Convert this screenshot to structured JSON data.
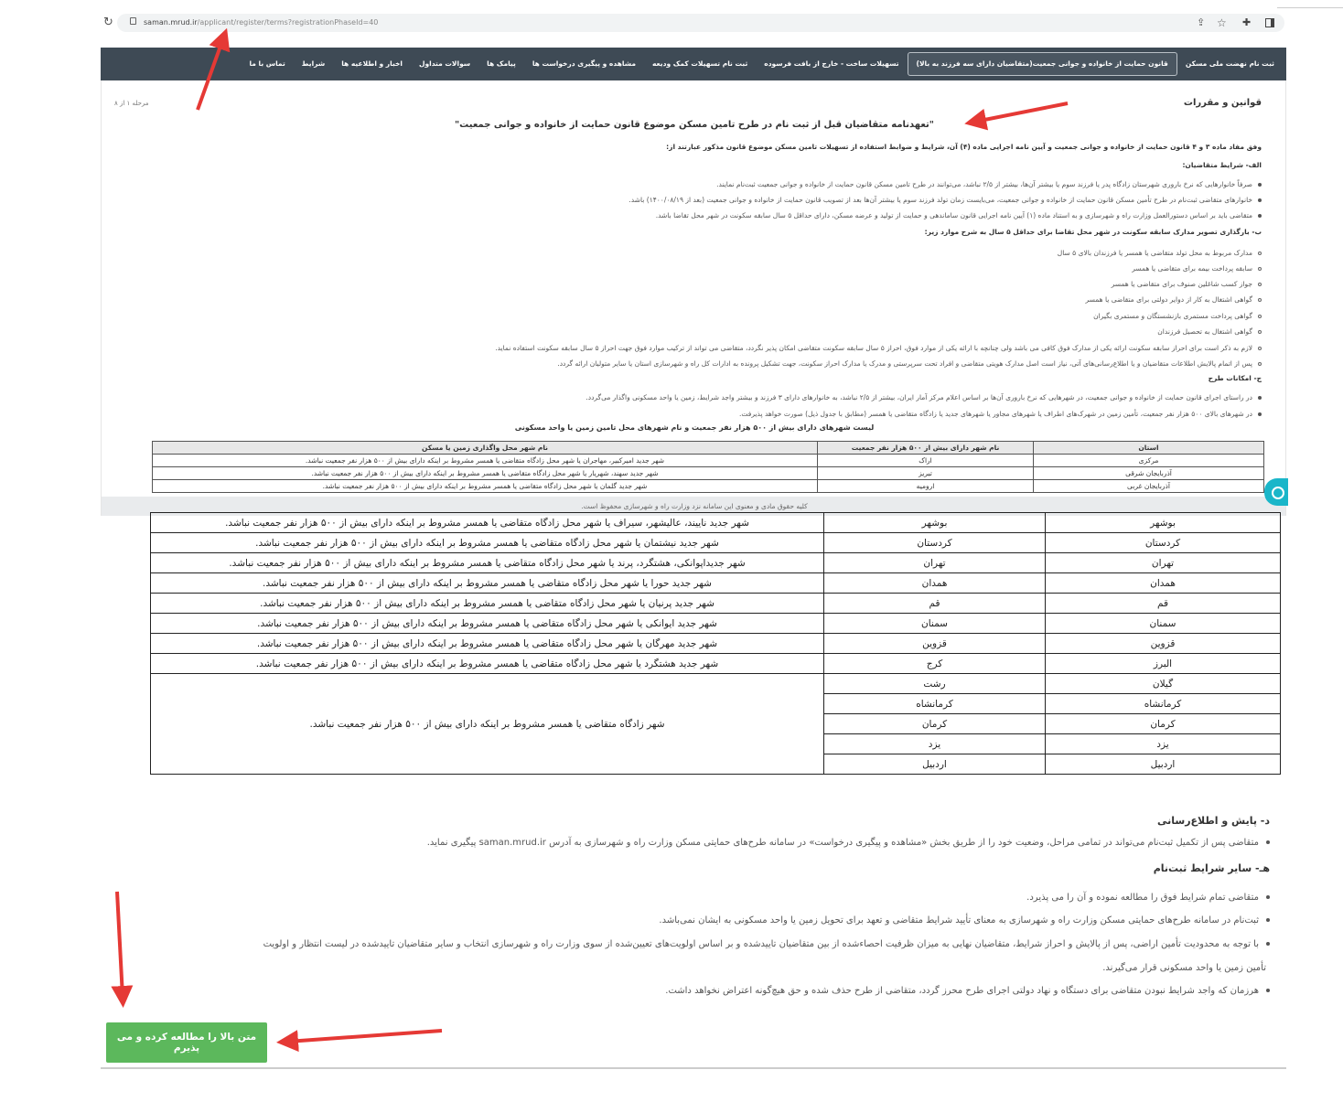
{
  "browser": {
    "url_host": "saman.mrud.ir",
    "url_path": "/applicant/register/terms?registrationPhaseId=40"
  },
  "nav": {
    "items": [
      "ثبت نام نهضت ملی مسکن",
      "قانون حمایت از خانواده و جوانی جمعیت(متقاضیان دارای سه فرزند به بالا)",
      "تسهیلات ساخت - خارج از بافت فرسوده",
      "ثبت نام تسهیلات کمک ودیعه",
      "مشاهده و پیگیری درخواست ها",
      "پیامک ها",
      "سوالات متداول",
      "اخبار و اطلاعیه ها",
      "شرایط",
      "تماس با ما"
    ]
  },
  "page": {
    "section_title": "قوانین و مقررات",
    "step_label": "مرحله ۱ از ۸",
    "heading": "\"تعهدنامه متقاضیان قبل از ثبت نام در طرح تامین مسکن موضوع قانون حمایت از خانواده و جوانی جمعیت\"",
    "intro": "وفق مفاد ماده ۳ و ۴ قانون حمایت از خانواده و جوانی جمعیت و آیین نامه اجرایی ماده (۴) آن، شرایط و ضوابط استفاده از تسهیلات تامین مسکن موضوع قانون مذکور عبارتند از:",
    "section_a": "الف- شرایط متقاضیان:",
    "a_items": [
      "صرفاً خانوارهایی که نرخ باروری شهرستان زادگاه پدر یا فرزند سوم یا بیشتر آن‌ها، بیشتر از ۲/۵ نباشد، می‌توانند در طرح تامین مسکن قانون حمایت از خانواده و جوانی جمعیت ثبت‌نام نمایند.",
      "خانوارهای متقاضی ثبت‌نام در طرح تأمین مسکن قانون حمایت از خانواده و جوانی جمعیت، می‌بایست زمان تولد فرزند سوم یا بیشتر آن‌ها بعد از تصویب قانون حمایت از خانواده و جوانی جمعیت (بعد از ۱۴۰۰/۰۸/۱۹) باشد.",
      "متقاضی باید بر اساس دستورالعمل وزارت راه و شهرسازی و به استناد ماده (۱) آیین نامه اجرایی قانون ساماندهی و حمایت از تولید و عرضه مسکن، دارای حداقل ۵ سال سابقه سکونت در شهر محل تقاضا باشد."
    ],
    "section_b": "ب- بارگذاری تصویر مدارک سابقه سکونت در شهر محل تقاضا برای حداقل ۵ سال به شرح موارد زیر:",
    "b_items": [
      "مدارک مربوط به محل تولد متقاضی یا همسر یا فرزندان بالای ۵ سال",
      "سابقه پرداخت بیمه برای متقاضی یا همسر",
      "جواز کسب شاغلین صنوف برای متقاضی یا همسر",
      "گواهی اشتغال به کار از دوایر دولتی برای متقاضی یا همسر",
      "گواهی پرداخت مستمری بازنشستگان و مستمری بگیران",
      "گواهی اشتغال به تحصیل فرزندان",
      "لازم به ذکر است برای احراز سابقه سکونت ارائه یکی از مدارک فوق کافی می باشد ولی چنانچه  با ارائه یکی از موارد فوق، احراز ۵ سال سابقه سکونت متقاضی امکان پذیر نگردد، متقاضی می تواند از ترکیب موارد فوق جهت احراز ۵ سال سابقه سکونت استفاده نماید.",
      "پس از اتمام پالایش اطلاعات متقاضیان و یا اطلاع‌رسانی‌های آتی، نیاز است اصل مدارک  هویتی متقاضی و افراد تحت سرپرستی و مدرک یا مدارک احراز سکونت، جهت تشکیل پرونده به ادارات کل راه و شهرسازی استان یا سایر متولیان ارائه گردد."
    ],
    "section_c": "ج- امکانات طرح",
    "c_items": [
      "در راستای اجرای قانون حمایت از خانواده و جوانی جمعیت، در شهرهایی که نرخ باروری آن‌ها بر اساس اعلام مرکز آمار ایران، بیشتر از ۲/۵ نباشد، به خانوارهای دارای ۳ فرزند و بیشتر واجد شرایط، زمین یا واحد مسکونی واگذار می‌گردد.",
      "در شهرهای بالای ۵۰۰ هزار نفر جمعیت، تأمین زمین در شهرک‌های اطراف یا شهرهای مجاور یا شهرهای جدید یا زادگاه متقاضی یا همسر (مطابق با جدول ذیل) صورت خواهد پذیرفت."
    ],
    "table_caption": "لیست شهرهای دارای بیش از ۵۰۰ هزار نفر جمعیت و نام شهرهای محل تامین زمین یا واحد مسکونی",
    "table_headers": [
      "استان",
      "نام شهر دارای بیش از ۵۰۰ هزار نفر جمعیت",
      "نام شهر محل واگذاری زمین یا مسکن"
    ],
    "table_rows": [
      [
        "مرکزی",
        "اراک",
        "شهر جدید امیرکبیر، مهاجران یا شهر محل زادگاه متقاضی یا همسر مشروط بر اینکه دارای  بیش از ۵۰۰ هزار نفر جمعیت نباشد."
      ],
      [
        "آذربایجان شرقی",
        "تبریز",
        "شهر جدید سهند، شهریار یا شهر محل زادگاه متقاضی یا همسر مشروط بر اینکه دارای  بیش از ۵۰۰ هزار نفر جمعیت نباشد."
      ],
      [
        "آذربایجان غربی",
        "ارومیه",
        "شهر جدید گلمان یا شهر محل زادگاه متقاضی یا همسر مشروط بر اینکه دارای  بیش از ۵۰۰ هزار نفر جمعیت نباشد."
      ]
    ],
    "footer_note": "کلیه حقوق مادی و معنوی این سامانه نزد وزارت راه و شهرسازی محفوظ است."
  },
  "lower_table": {
    "rows": [
      [
        "بوشهر",
        "بوشهر",
        "شهر جدید ناییند، عالیشهر، سیراف یا شهر محل زادگاه متقاضی یا همسر مشروط بر اینکه دارای  بیش از ۵۰۰ هزار نفر جمعیت نباشد."
      ],
      [
        "کردستان",
        "کردستان",
        "شهر جدید نیشتمان یا شهر محل زادگاه متقاضی یا همسر مشروط بر اینکه دارای  بیش از ۵۰۰ هزار نفر جمعیت نباشد."
      ],
      [
        "تهران",
        "تهران",
        "شهر جدیداپوانکی، هشتگرد، پرند یا شهر محل زادگاه متقاضی یا همسر مشروط بر اینکه دارای  بیش از ۵۰۰ هزار نفر جمعیت نباشد."
      ],
      [
        "همدان",
        "همدان",
        "شهر جدید حورا یا شهر محل زادگاه متقاضی یا همسر مشروط بر اینکه دارای  بیش از ۵۰۰ هزار نفر جمعیت نباشد."
      ],
      [
        "قم",
        "قم",
        "شهر جدید پرنیان یا شهر محل زادگاه متقاضی یا همسر مشروط بر اینکه دارای  بیش از ۵۰۰ هزار نفر جمعیت نباشد."
      ],
      [
        "سمنان",
        "سمنان",
        "شهر جدید ایوانکی یا شهر محل زادگاه متقاضی یا همسر مشروط بر اینکه دارای  بیش از ۵۰۰ هزار نفر جمعیت نباشد."
      ],
      [
        "قزوین",
        "قزوین",
        "شهر جدید مهرگان یا شهر محل زادگاه متقاضی یا همسر مشروط بر اینکه دارای  بیش از ۵۰۰ هزار نفر جمعیت نباشد."
      ],
      [
        "البرز",
        "کرج",
        "شهر جدید هشتگرد یا شهر محل زادگاه متقاضی یا همسر مشروط بر اینکه دارای  بیش از ۵۰۰ هزار نفر جمعیت نباشد."
      ]
    ],
    "group_rows": [
      [
        "گیلان",
        "رشت"
      ],
      [
        "کرمانشاه",
        "کرمانشاه"
      ],
      [
        "کرمان",
        "کرمان"
      ],
      [
        "یزد",
        "یزد"
      ],
      [
        "اردبیل",
        "اردبیل"
      ]
    ],
    "group_text": "شهر زادگاه متقاضی یا همسر مشروط بر اینکه دارای  بیش از ۵۰۰ هزار نفر جمعیت نباشد."
  },
  "lower": {
    "section_d": "د- پایش و اطلاع‌رسانی",
    "d_item": "متقاضی پس از تکمیل ثبت‌نام می‌تواند در تمامی مراحل، وضعیت خود را از طریق بخش «مشاهده و پیگیری درخواست» در سامانه طرح‌های حمایتی مسکن وزارت راه و شهرسازی به آدرس saman.mrud.ir پیگیری نماید.",
    "section_e": "هـ- سایر شرایط ثبت‌نام",
    "e_items": [
      "متقاضی تمام شرایط فوق را مطالعه نموده و آن را می پذیرد.",
      "ثبت‌نام در سامانه طرح‌های حمایتی مسکن وزارت راه و شهرسازی به معنای تأیید شرایط متقاضی و تعهد برای تحویل زمین یا واحد مسکونی به ایشان نمی‌باشد.",
      "با توجه به محدودیت تأمین اراضی، پس از پالایش و احراز شرایط، متقاضیان نهایی به میزان ظرفیت احصاءشده از بین متقاضیان تاییدشده و بر اساس اولویت‌های تعیین‌شده از سوی وزارت راه و شهرسازی انتخاب و سایر متقاضیان تاییدشده در لیست انتظار و اولویت",
      "هرزمان که واجد شرایط نبودن متقاضی برای دستگاه و نهاد دولتی اجرای طرح محرز گردد، متقاضی از طرح حذف شده و حق هیچ‌گونه اعتراض نخواهد داشت."
    ],
    "e_item3_cont": "تأمین زمین یا واحد مسکونی قرار می‌گیرند.",
    "accept_button": "متن بالا را مطالعه کرده و می پذیرم"
  },
  "colors": {
    "nav_bg": "#3e4a55",
    "button_green": "#5cb85c",
    "arrow_red": "#e53935",
    "chat_teal": "#1ab6c9"
  }
}
